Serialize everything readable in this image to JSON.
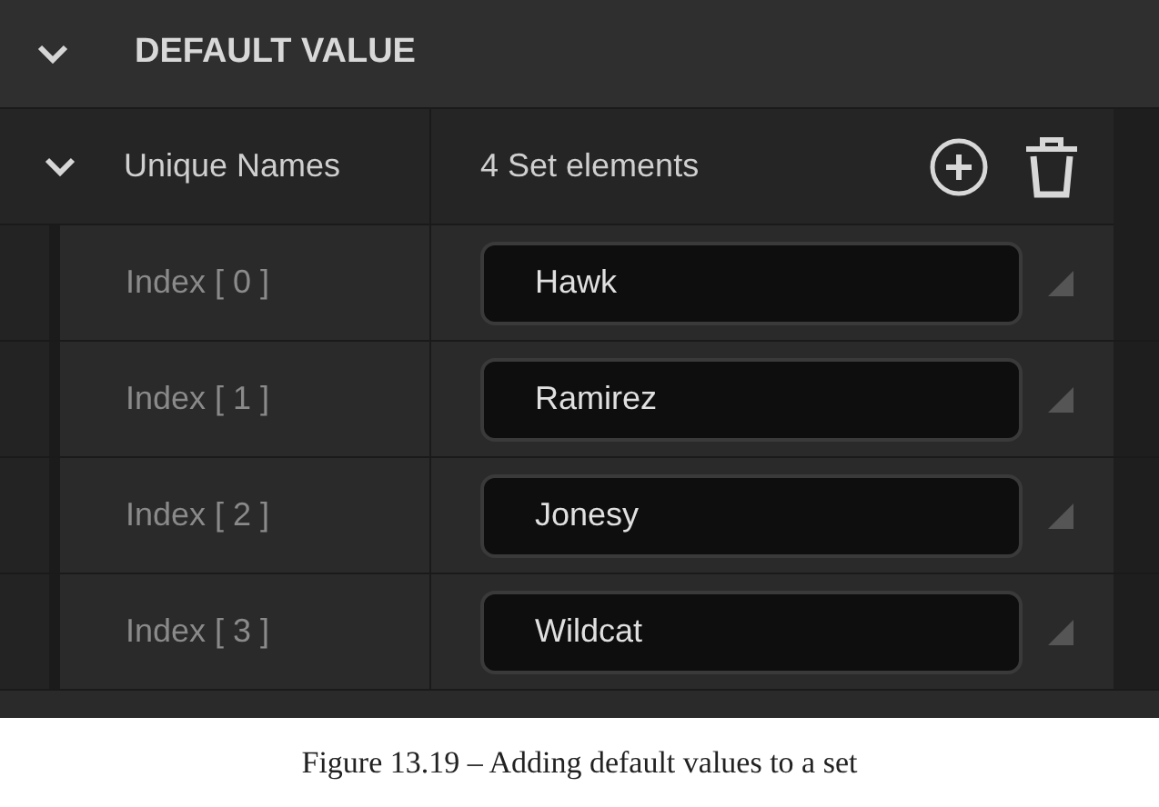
{
  "section": {
    "title": "DEFAULT VALUE",
    "expanded": true
  },
  "property": {
    "name": "Unique Names",
    "expanded": true,
    "summary": "4 Set elements"
  },
  "elements": [
    {
      "label": "Index [ 0 ]",
      "value": "Hawk"
    },
    {
      "label": "Index [ 1 ]",
      "value": "Ramirez"
    },
    {
      "label": "Index [ 2 ]",
      "value": "Jonesy"
    },
    {
      "label": "Index [ 3 ]",
      "value": "Wildcat"
    }
  ],
  "caption": "Figure 13.19 – Adding default values to a set"
}
